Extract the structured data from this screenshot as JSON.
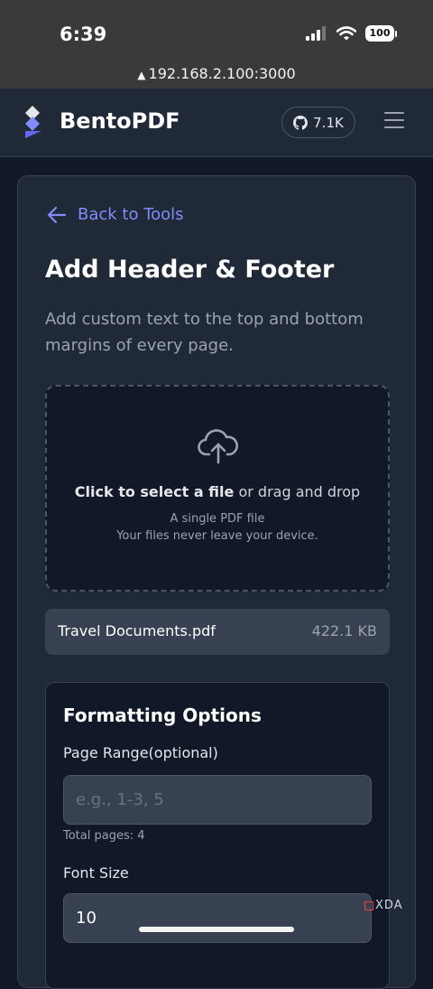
{
  "status_bar": {
    "time": "6:39",
    "battery": "100"
  },
  "browser": {
    "url": "192.168.2.100:3000"
  },
  "header": {
    "brand": "BentoPDF",
    "github_stars": "7.1K",
    "accent_color": "#818cf8"
  },
  "tool": {
    "back_label": "Back to Tools",
    "title": "Add Header & Footer",
    "description": "Add custom text to the top and bottom margins of every page."
  },
  "dropzone": {
    "click_text": "Click to select a file",
    "drag_text": " or drag and drop",
    "file_hint": "A single PDF file",
    "privacy_note": "Your files never leave your device."
  },
  "file": {
    "name": "Travel Documents.pdf",
    "size": "422.1 KB"
  },
  "options": {
    "title": "Formatting Options",
    "page_range_label": "Page Range(optional)",
    "page_range_placeholder": "e.g., 1-3, 5",
    "page_range_value": "",
    "total_pages": "Total pages: 4",
    "font_size_label": "Font Size",
    "font_size_value": "10"
  },
  "watermark": "XDA"
}
